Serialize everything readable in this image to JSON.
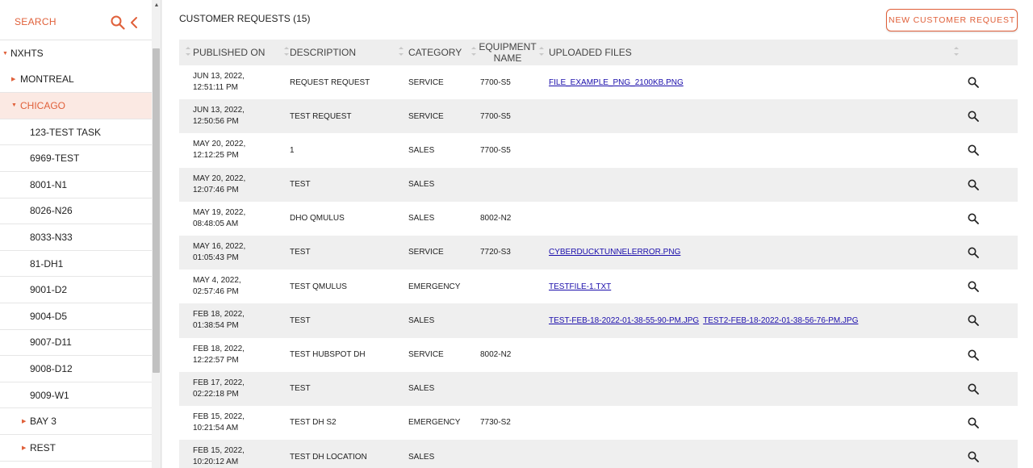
{
  "sidebar": {
    "search_label": "SEARCH",
    "root": "NXHTS",
    "items": [
      {
        "label": "MONTREAL",
        "level": 1,
        "caret": true,
        "active": false
      },
      {
        "label": "CHICAGO",
        "level": 1,
        "caret": true,
        "active": true
      },
      {
        "label": "123-TEST TASK",
        "level": 2,
        "caret": false,
        "active": false
      },
      {
        "label": "6969-TEST",
        "level": 2,
        "caret": false,
        "active": false
      },
      {
        "label": "8001-N1",
        "level": 2,
        "caret": false,
        "active": false
      },
      {
        "label": "8026-N26",
        "level": 2,
        "caret": false,
        "active": false
      },
      {
        "label": "8033-N33",
        "level": 2,
        "caret": false,
        "active": false
      },
      {
        "label": "81-DH1",
        "level": 2,
        "caret": false,
        "active": false
      },
      {
        "label": "9001-D2",
        "level": 2,
        "caret": false,
        "active": false
      },
      {
        "label": "9004-D5",
        "level": 2,
        "caret": false,
        "active": false
      },
      {
        "label": "9007-D11",
        "level": 2,
        "caret": false,
        "active": false
      },
      {
        "label": "9008-D12",
        "level": 2,
        "caret": false,
        "active": false
      },
      {
        "label": "9009-W1",
        "level": 2,
        "caret": false,
        "active": false
      },
      {
        "label": "BAY 3",
        "level": 2,
        "caret": true,
        "active": false
      },
      {
        "label": "REST",
        "level": 2,
        "caret": true,
        "active": false
      }
    ]
  },
  "header": {
    "title": "CUSTOMER REQUESTS (15)",
    "new_button": "NEW CUSTOMER REQUEST"
  },
  "table": {
    "columns": {
      "published": "PUBLISHED ON",
      "description": "DESCRIPTION",
      "category": "CATEGORY",
      "equipment_line1": "EQUIPMENT",
      "equipment_line2": "NAME",
      "files": "UPLOADED FILES"
    },
    "rows": [
      {
        "date": "JUN 13, 2022,",
        "time": "12:51:11 PM",
        "description": "REQUEST REQUEST",
        "category": "SERVICE",
        "equipment": "7700-S5",
        "files": [
          "FILE_EXAMPLE_PNG_2100KB.PNG"
        ]
      },
      {
        "date": "JUN 13, 2022,",
        "time": "12:50:56 PM",
        "description": "TEST REQUEST",
        "category": "SERVICE",
        "equipment": "7700-S5",
        "files": []
      },
      {
        "date": "MAY 20, 2022,",
        "time": "12:12:25 PM",
        "description": "1",
        "category": "SALES",
        "equipment": "7700-S5",
        "files": []
      },
      {
        "date": "MAY 20, 2022,",
        "time": "12:07:46 PM",
        "description": "TEST",
        "category": "SALES",
        "equipment": "",
        "files": []
      },
      {
        "date": "MAY 19, 2022,",
        "time": "08:48:05 AM",
        "description": "DHO QMULUS",
        "category": "SALES",
        "equipment": "8002-N2",
        "files": []
      },
      {
        "date": "MAY 16, 2022,",
        "time": "01:05:43 PM",
        "description": "TEST",
        "category": "SERVICE",
        "equipment": "7720-S3",
        "files": [
          "CYBERDUCKTUNNELERROR.PNG"
        ]
      },
      {
        "date": "MAY 4, 2022,",
        "time": "02:57:46 PM",
        "description": "TEST QMULUS",
        "category": "EMERGENCY",
        "equipment": "",
        "files": [
          "TESTFILE-1.TXT"
        ]
      },
      {
        "date": "FEB 18, 2022,",
        "time": "01:38:54 PM",
        "description": "TEST",
        "category": "SALES",
        "equipment": "",
        "files": [
          "TEST-FEB-18-2022-01-38-55-90-PM.JPG",
          "TEST2-FEB-18-2022-01-38-56-76-PM.JPG"
        ]
      },
      {
        "date": "FEB 18, 2022,",
        "time": "12:22:57 PM",
        "description": "TEST HUBSPOT DH",
        "category": "SERVICE",
        "equipment": "8002-N2",
        "files": []
      },
      {
        "date": "FEB 17, 2022,",
        "time": "02:22:18 PM",
        "description": "TEST",
        "category": "SALES",
        "equipment": "",
        "files": []
      },
      {
        "date": "FEB 15, 2022,",
        "time": "10:21:54 AM",
        "description": "TEST DH S2",
        "category": "EMERGENCY",
        "equipment": "7730-S2",
        "files": []
      },
      {
        "date": "FEB 15, 2022,",
        "time": "10:20:12 AM",
        "description": "TEST DH LOCATION",
        "category": "SALES",
        "equipment": "",
        "files": []
      }
    ]
  },
  "colors": {
    "accent": "#e0603a",
    "active_bg": "#fbe9e3",
    "link": "#1a0dab"
  }
}
